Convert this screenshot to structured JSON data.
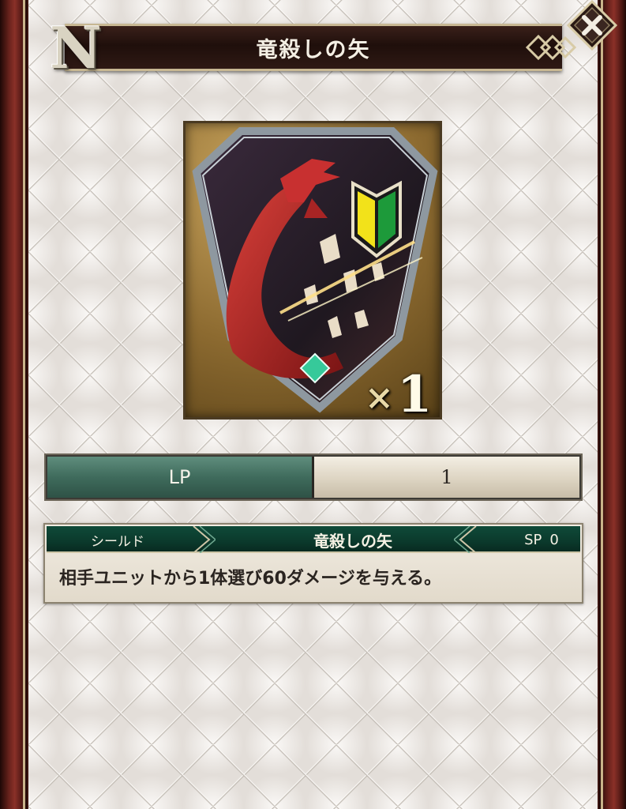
{
  "header": {
    "badge": "N",
    "title": "竜殺しの矢",
    "close_label": "×"
  },
  "card": {
    "quantity_prefix": "×",
    "quantity": "1"
  },
  "stats": {
    "lp_label": "LP",
    "lp_value": "1"
  },
  "skill": {
    "type": "シールド",
    "name": "竜殺しの矢",
    "sp_label": "SP",
    "sp_value": "0",
    "description": "相手ユニットから1体選び60ダメージを与える。"
  },
  "colors": {
    "title_bar": "#1f0f0b",
    "frame": "#6b231d",
    "lp_label_bg": "#3f6b5c",
    "skill_header_bg": "#0b3a2c",
    "beginner_mark_green": "#1d9a3a",
    "beginner_mark_yellow": "#f2e21a"
  }
}
